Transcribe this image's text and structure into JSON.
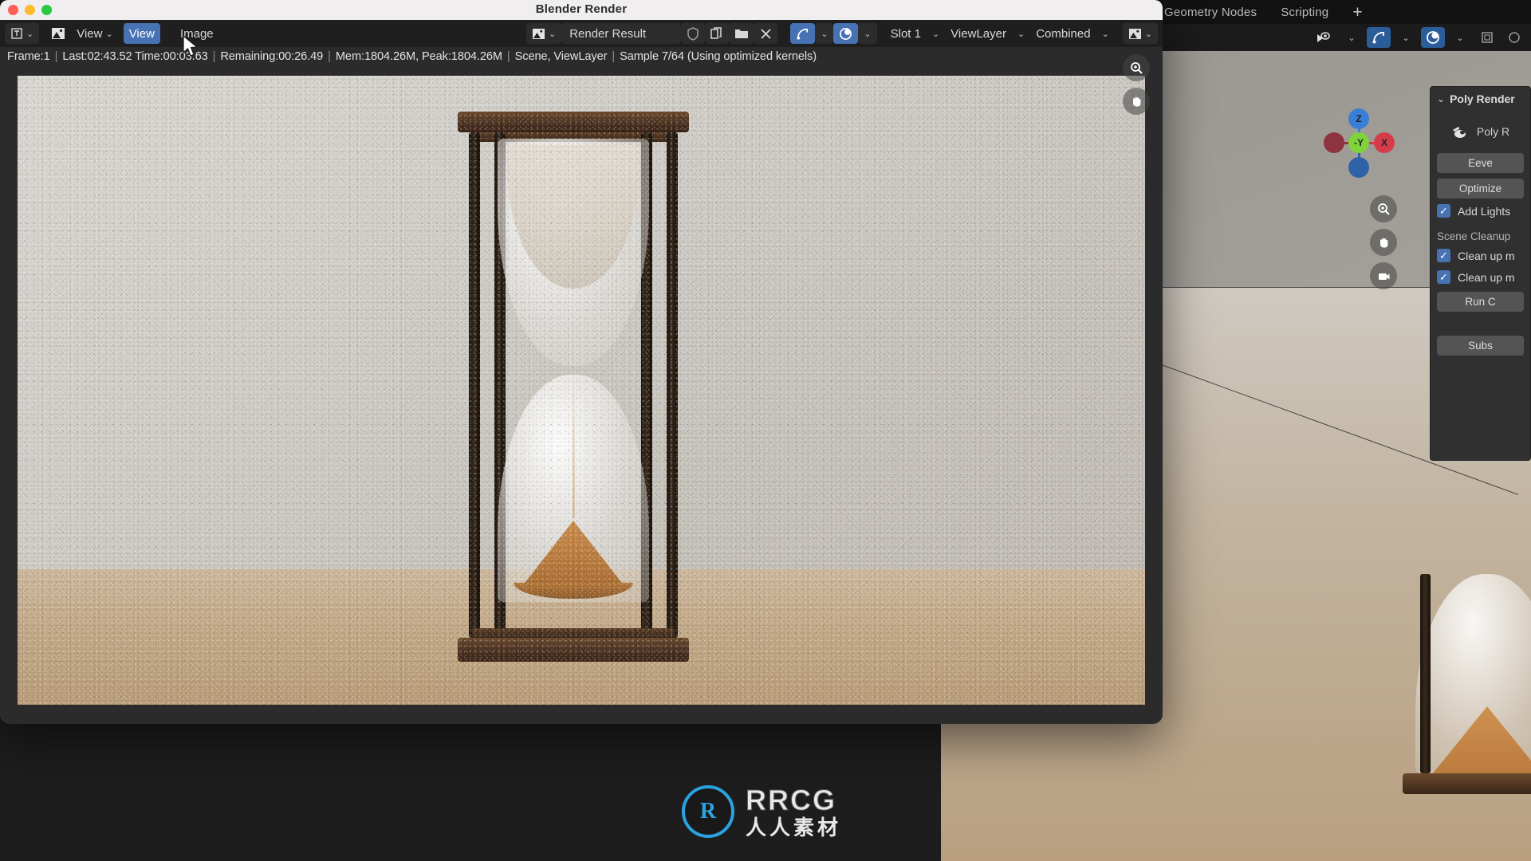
{
  "app": {
    "topbar_tabs": [
      {
        "label": "Geometry Nodes"
      },
      {
        "label": "Scripting"
      },
      {
        "label": "+"
      }
    ]
  },
  "render_window": {
    "title": "Blender Render",
    "traffic_lights": {
      "close_color": "#ff5f57",
      "minimize_color": "#febc2e",
      "zoom_color": "#28c840"
    },
    "header": {
      "editor_type_icon": "editor-type-icon",
      "menus": [
        {
          "label": "View",
          "icon": "image-icon",
          "state": "normal"
        },
        {
          "label": "View",
          "state": "highlighted"
        },
        {
          "label": "Image",
          "state": "normal"
        }
      ],
      "datablock_icon": "image-datablock-icon",
      "datablock_name": "Render Result",
      "actions": [
        {
          "name": "shield-icon",
          "glyph": "shield"
        },
        {
          "name": "copy-icon",
          "glyph": "copy"
        },
        {
          "name": "folder-icon",
          "glyph": "folder"
        },
        {
          "name": "close-icon",
          "glyph": "x"
        }
      ],
      "toggles": [
        {
          "name": "display-channels-icon",
          "active": true
        },
        {
          "name": "render-pass-icon",
          "active": true
        }
      ],
      "slot": "Slot 1",
      "view_layer": "ViewLayer",
      "pass": "Combined",
      "tool_icon": "image-tools-icon"
    },
    "status": {
      "frame": "Frame:1",
      "last": "Last:02:43.52 Time:00:03.63",
      "remaining": "Remaining:00:26.49",
      "memory": "Mem:1804.26M, Peak:1804.26M",
      "scene": "Scene, ViewLayer",
      "sample": "Sample 7/64 (Using optimized kernels)"
    },
    "overlay_buttons": [
      {
        "name": "zoom-in-button",
        "glyph": "zoom"
      },
      {
        "name": "pan-button",
        "glyph": "hand"
      }
    ]
  },
  "viewport": {
    "header_buttons": [
      {
        "name": "visibility-icon"
      },
      {
        "name": "snap-icon",
        "active": true
      },
      {
        "name": "shading-icon",
        "active": true
      },
      {
        "name": "overlays-icon"
      }
    ],
    "overlay_buttons": [
      {
        "name": "zoom-button"
      },
      {
        "name": "pan-button"
      },
      {
        "name": "camera-button"
      }
    ],
    "gizmo": {
      "axes": [
        {
          "label": "Z",
          "color": "#3a7fd5",
          "angle": -90,
          "filled": true
        },
        {
          "label": "X",
          "color": "#d63b4a",
          "angle": 0,
          "filled": true
        },
        {
          "label": "-Y",
          "color": "#7fd33a",
          "angle": 0,
          "filled": true
        },
        {
          "label": "",
          "color": "#2f63a8",
          "angle": 90,
          "filled": true
        },
        {
          "label": "",
          "color": "#8e3340",
          "angle": 180,
          "filled": true
        }
      ]
    }
  },
  "properties_panel": {
    "header": "Poly Render",
    "brand": "Poly R",
    "buttons": [
      {
        "label": "Eeve"
      },
      {
        "label": "Optimize"
      }
    ],
    "add_lights": {
      "label": "Add Lights",
      "checked": true
    },
    "section_label": "Scene Cleanup",
    "checkboxes": [
      {
        "label": "Clean up m",
        "checked": true
      },
      {
        "label": "Clean up m",
        "checked": true
      }
    ],
    "run_button": "Run C",
    "sub_button": "Subs"
  },
  "watermark": {
    "logo": "RRCG-logo-icon",
    "title": "RRCG",
    "subtitle": "人人素材"
  }
}
